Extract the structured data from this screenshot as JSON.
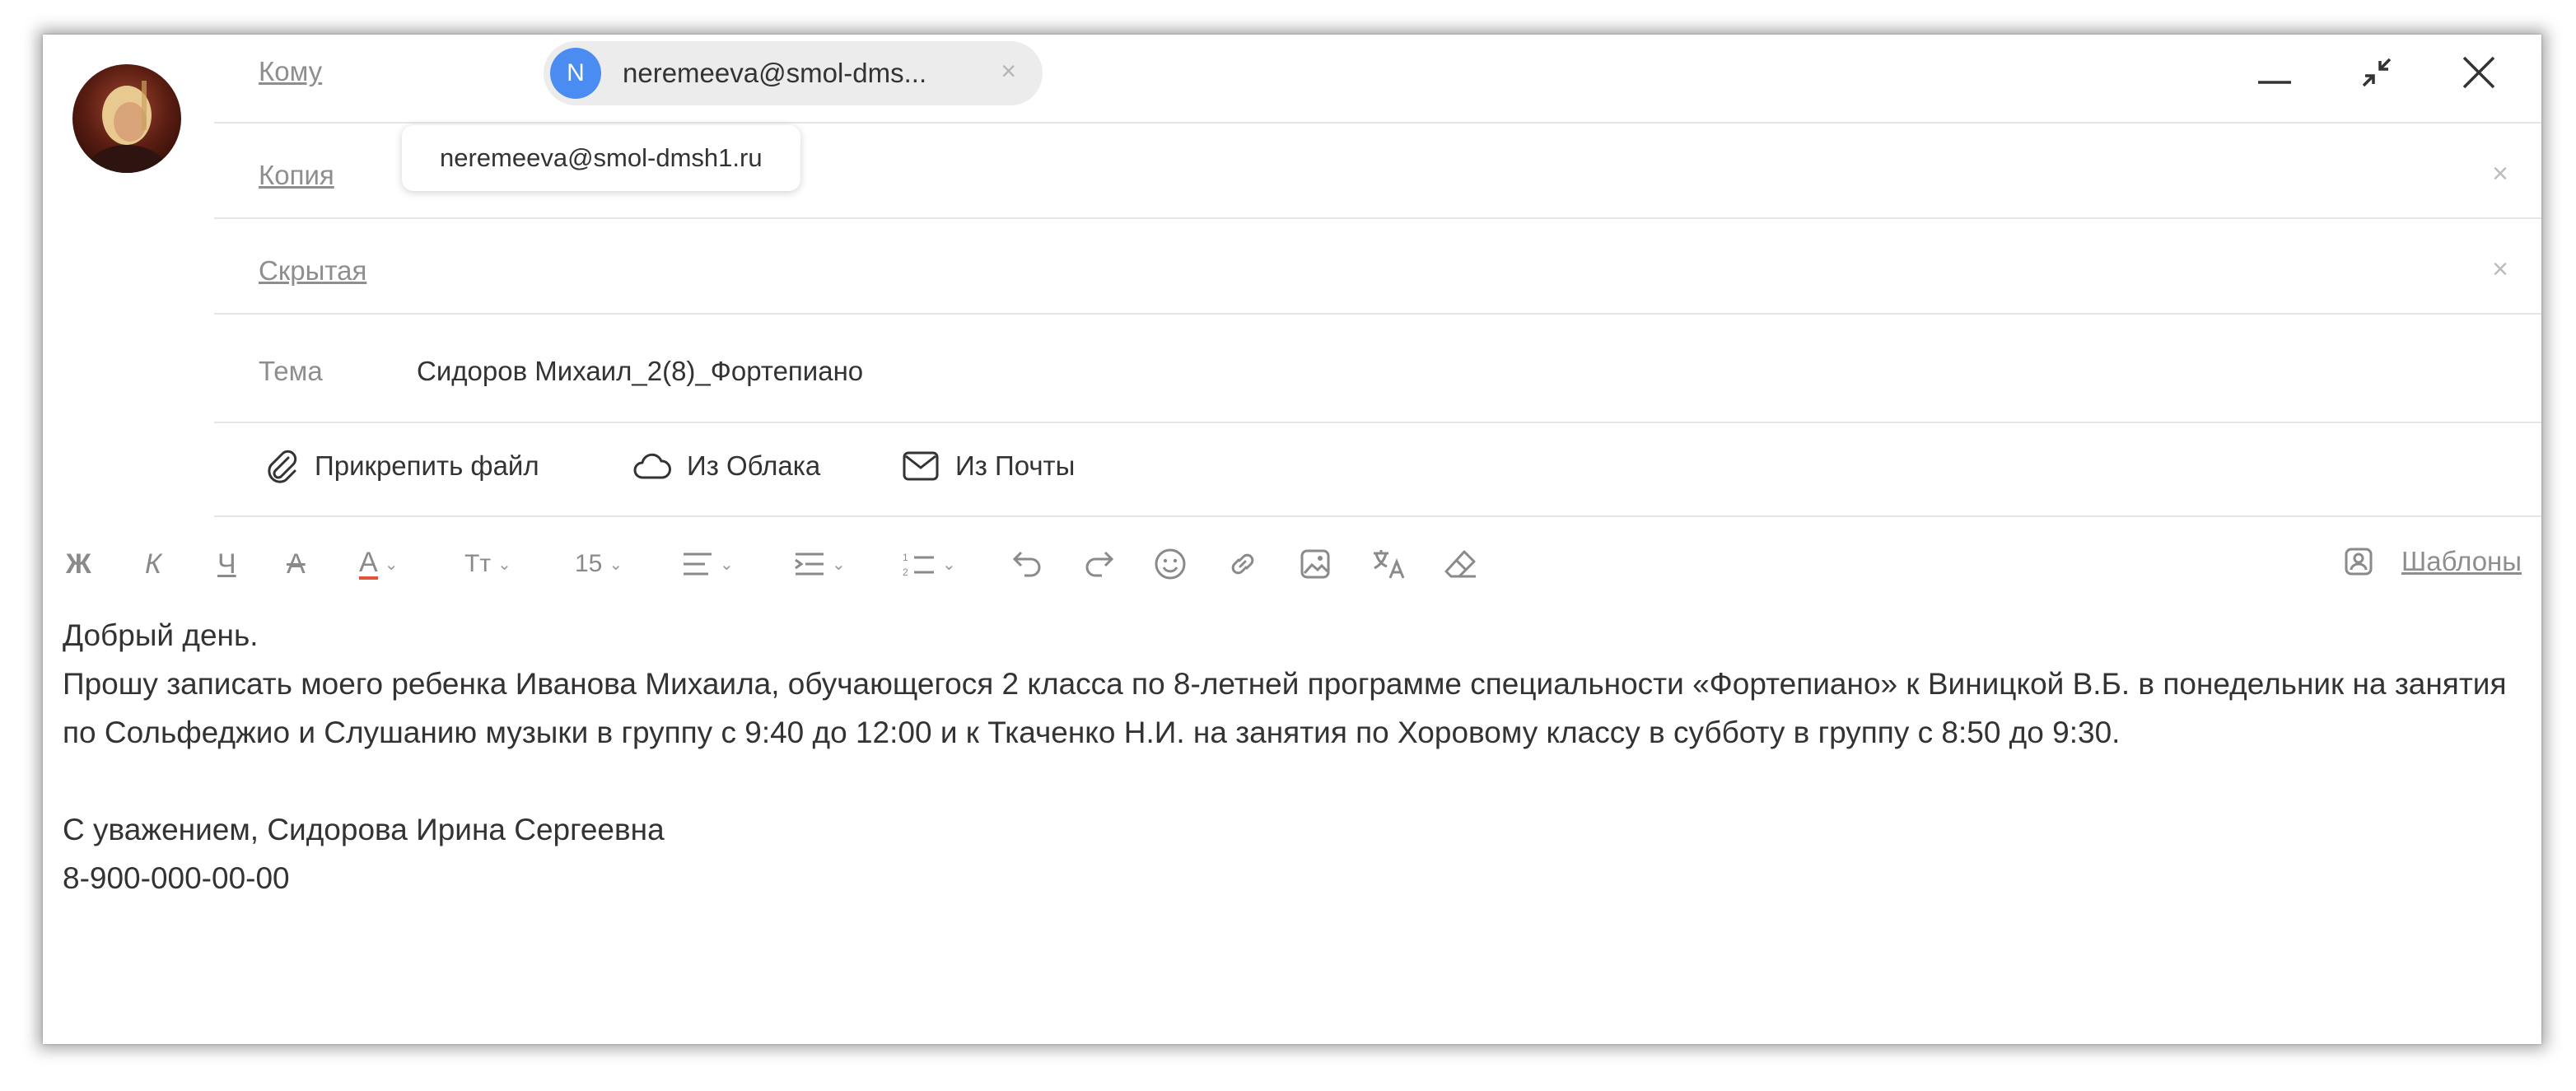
{
  "compose": {
    "to_label": "Кому",
    "cc_label": "Копия",
    "bcc_label": "Скрытая",
    "subject_label": "Тема",
    "subject_value": "Сидоров Михаил_2(8)_Фортепиано",
    "recipient": {
      "initial": "N",
      "short": "neremeeva@smol-dms...",
      "full": "neremeeva@smol-dmsh1.ru",
      "remove": "×"
    },
    "clear_glyph": "×"
  },
  "attach": {
    "file_label": "Прикрепить файл",
    "cloud_label": "Из Облака",
    "mail_label": "Из Почты"
  },
  "toolbar": {
    "bold": "Ж",
    "italic": "К",
    "underline": "Ч",
    "strike": "А",
    "text_color": "А",
    "font_style": "Тт",
    "font_size": "15",
    "templates_label": "Шаблоны"
  },
  "body": {
    "greeting": "Добрый день.",
    "paragraph": "Прошу записать моего ребенка Иванова Михаила, обучающегося 2 класса по 8-летней программе специальности «Фортепиано» к Виницкой В.Б. в понедельник на занятия по Сольфеджио и Слушанию музыки в группу с 9:40 до 12:00 и к Ткаченко Н.И. на занятия по Хоровому классу в субботу в группу с 8:50 до 9:30.",
    "regards": "С уважением, Сидорова Ирина Сергеевна",
    "phone": "8-900-000-00-00"
  },
  "colors": {
    "chip_avatar": "#4a8cf2",
    "text_color_underline": "#e0533a"
  }
}
